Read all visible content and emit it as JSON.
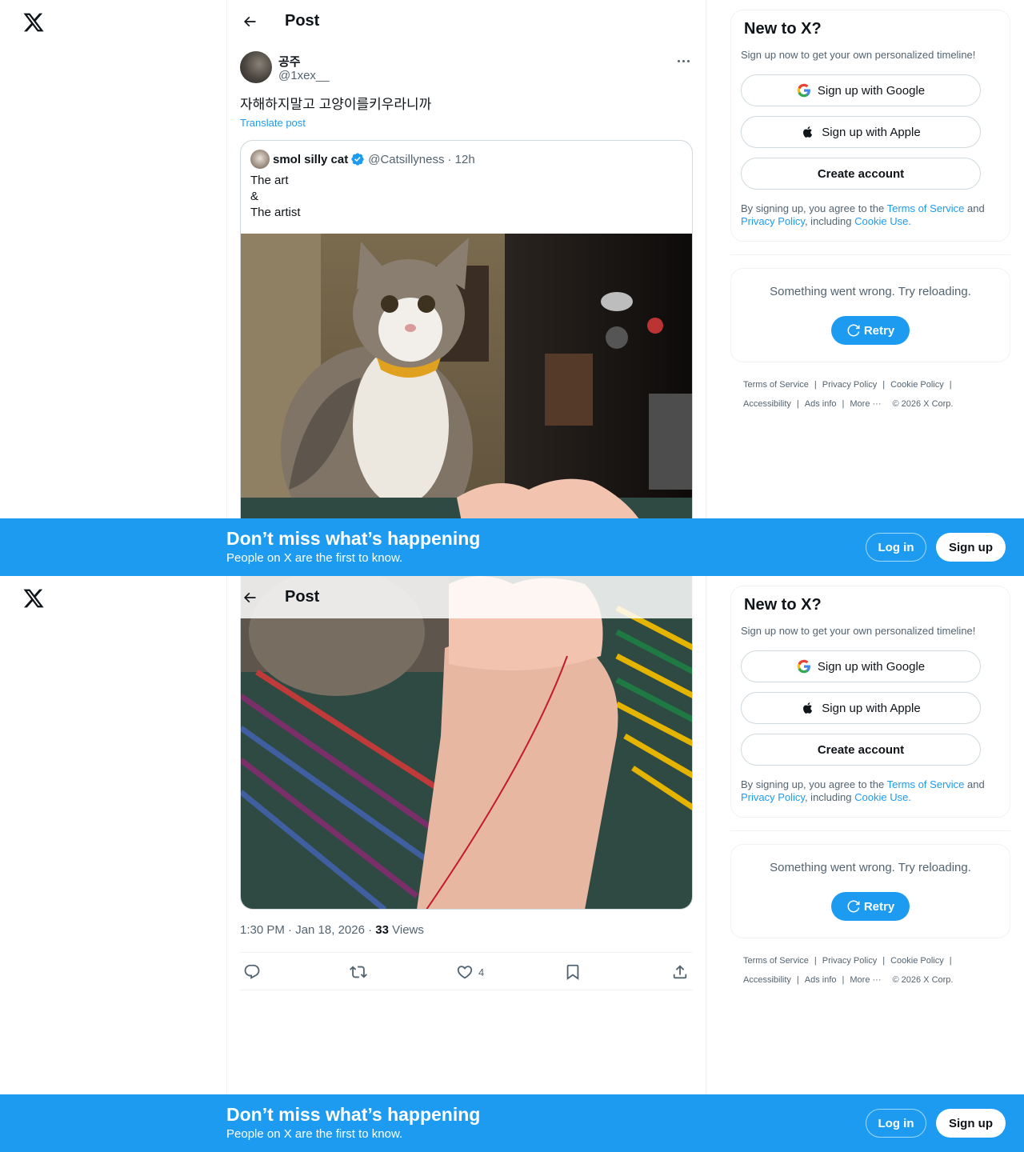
{
  "nav": {
    "logo": "x-logo-icon",
    "back_icon": "arrow-left-icon",
    "title": "Post"
  },
  "post": {
    "author_name": "공주",
    "author_handle": "@1xex__",
    "text": "자해하지말고 고양이를키우라니까",
    "translate_label": "Translate post",
    "timestamp": "1:30 PM · Jan 18, 2026",
    "views_count": "33",
    "views_label": "Views",
    "likes_count": "4"
  },
  "quote": {
    "author_name": "smol silly cat",
    "author_handle": "@Catsillyness",
    "age": "· 12h",
    "lines": [
      "The art",
      "&",
      "The artist"
    ]
  },
  "sidebar": {
    "title": "New to X?",
    "subtitle": "Sign up now to get your own personalized timeline!",
    "google_label": "Sign up with Google",
    "apple_label": "Sign up with Apple",
    "create_label": "Create account",
    "legal_prefix": "By signing up, you agree to the ",
    "terms_link": "Terms of Service",
    "legal_and": " and ",
    "privacy_link": "Privacy Policy",
    "legal_including": ", including ",
    "cookie_link": "Cookie Use.",
    "error_text": "Something went wrong. Try reloading.",
    "retry_label": "Retry"
  },
  "footer": {
    "terms": "Terms of Service",
    "privacy": "Privacy Policy",
    "cookie": "Cookie Policy",
    "accessibility": "Accessibility",
    "ads": "Ads info",
    "more": "More ···",
    "copyright": "© 2026 X Corp."
  },
  "banner": {
    "title": "Don’t miss what’s happening",
    "subtitle": "People on X are the first to know.",
    "login_label": "Log in",
    "signup_label": "Sign up"
  },
  "colors": {
    "accent": "#1d9bf0",
    "text": "#0f1419",
    "muted": "#536471",
    "border": "#cfd9de"
  }
}
